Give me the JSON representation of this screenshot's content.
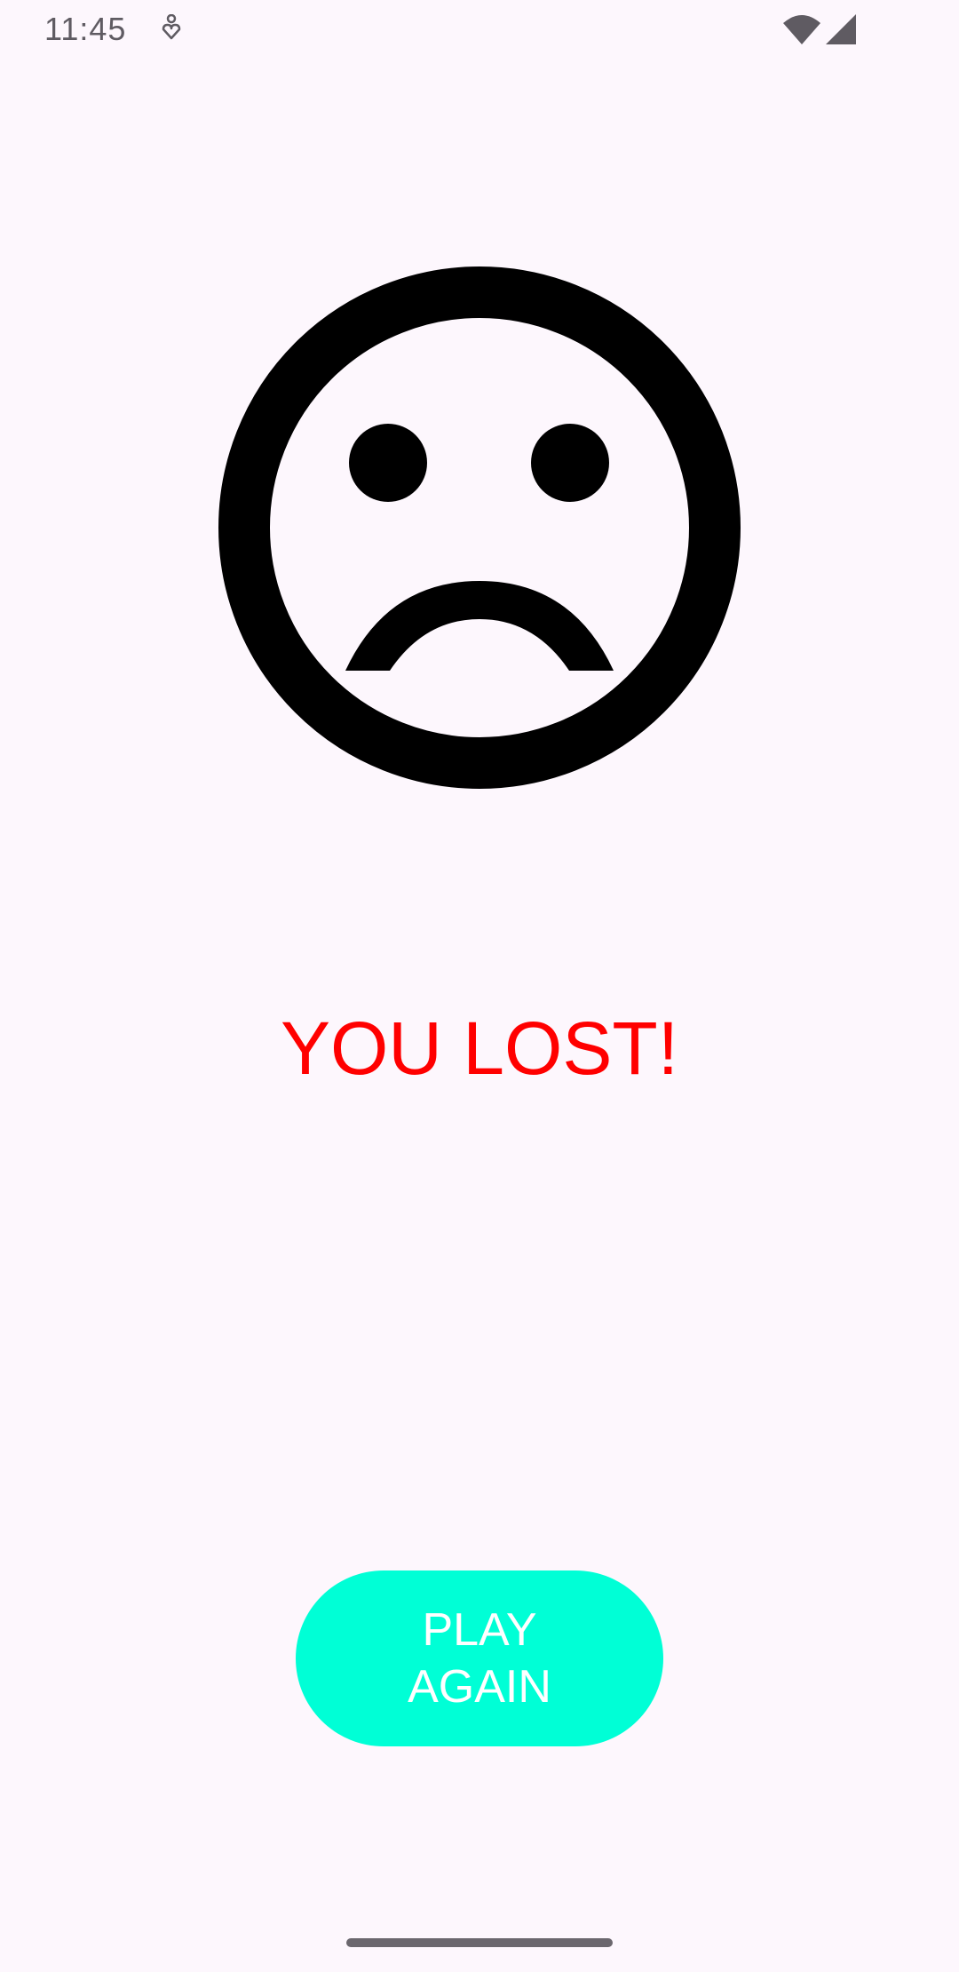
{
  "status_bar": {
    "time": "11:45",
    "icons": [
      "notification-icon",
      "wifi-icon",
      "signal-icon"
    ]
  },
  "main": {
    "face_icon": "sad-face-icon",
    "result_text": "YOU LOST!",
    "result_color": "#ff0000",
    "play_again_label": "PLAY AGAIN",
    "button_color": "#00ffd6"
  },
  "colors": {
    "background": "#fdf7fd",
    "status_icons": "#5f5b62"
  }
}
